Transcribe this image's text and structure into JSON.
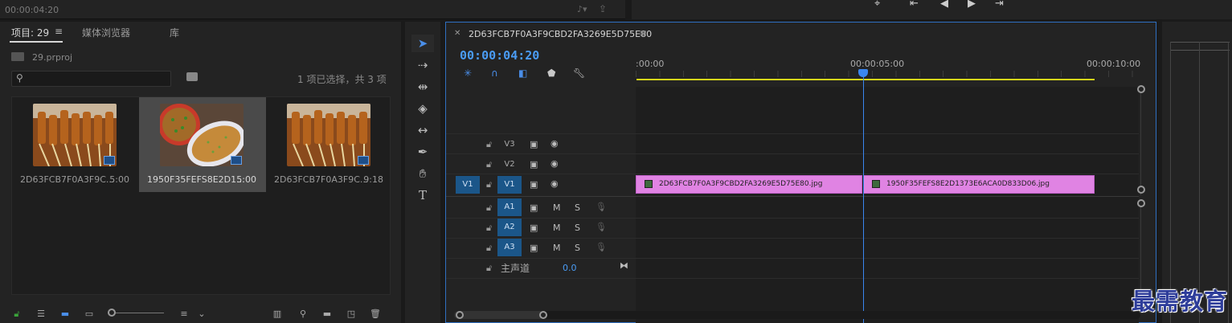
{
  "top": {
    "timecode": "00:00:04:20"
  },
  "project": {
    "tabs": [
      {
        "label": "项目: 29"
      },
      {
        "label": "媒体浏览器"
      },
      {
        "label": "库"
      }
    ],
    "menu_icon": "hamburger-icon",
    "file": "29.prproj",
    "search_placeholder": "",
    "selection_info": "1 项已选择，共 3 项",
    "clips": [
      {
        "name": "2D63FCB7F0A3F9C...",
        "duration": "5:00",
        "selected": false
      },
      {
        "name": "1950F35FEFS8E2D1...",
        "duration": "5:00",
        "selected": true
      },
      {
        "name": "2D63FCB7F0A3F9C...",
        "duration": "9:18",
        "selected": false
      }
    ]
  },
  "timeline": {
    "sequence_name": "2D63FCB7F0A3F9CBD2FA3269E5D75E80",
    "timecode": "00:00:04:20",
    "ruler": [
      ":00:00",
      "00:00:05:00",
      "00:00:10:00"
    ],
    "video_tracks": [
      {
        "source": "",
        "name": "V3"
      },
      {
        "source": "",
        "name": "V2"
      },
      {
        "source": "V1",
        "name": "V1"
      }
    ],
    "audio_tracks": [
      {
        "name": "A1",
        "m": "M",
        "s": "S"
      },
      {
        "name": "A2",
        "m": "M",
        "s": "S"
      },
      {
        "name": "A3",
        "m": "M",
        "s": "S"
      }
    ],
    "master": {
      "label": "主声道",
      "value": "0.0"
    },
    "clips": [
      {
        "label": "2D63FCB7F0A3F9CBD2FA3269E5D75E80.jpg"
      },
      {
        "label": "1950F35FEFS8E2D1373E6ACA0D833D06.jpg"
      }
    ]
  },
  "watermark": "最需教育",
  "colors": {
    "accent": "#4a9cf5",
    "clip": "#e083e3",
    "track_blue": "#1b5689",
    "work_area": "#d6d61a"
  }
}
